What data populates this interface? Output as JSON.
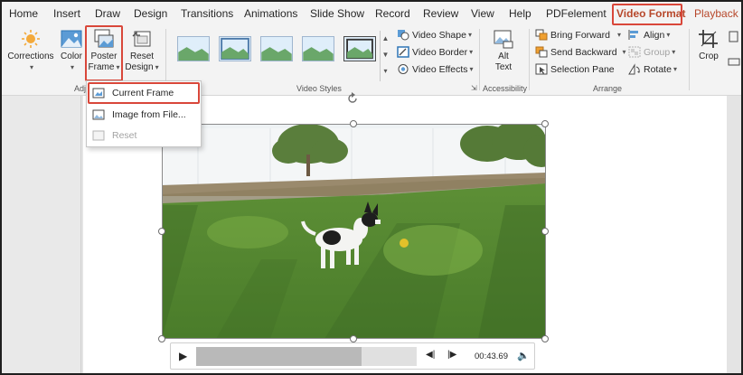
{
  "tabs": [
    "Home",
    "Insert",
    "Draw",
    "Design",
    "Transitions",
    "Animations",
    "Slide Show",
    "Record",
    "Review",
    "View",
    "Help",
    "PDFelement",
    "Video Format",
    "Playback"
  ],
  "ribbon": {
    "adjust": {
      "corrections": "Corrections",
      "color": "Color",
      "poster_frame_1": "Poster",
      "poster_frame_2": "Frame",
      "reset_design_1": "Reset",
      "reset_design_2": "Design",
      "label": "Adj"
    },
    "video_styles": {
      "video_shape": "Video Shape",
      "video_border": "Video Border",
      "video_effects": "Video Effects",
      "label": "Video Styles"
    },
    "accessibility": {
      "alt_text_1": "Alt",
      "alt_text_2": "Text",
      "label": "Accessibility"
    },
    "arrange": {
      "bring_forward": "Bring Forward",
      "send_backward": "Send Backward",
      "selection_pane": "Selection Pane",
      "align": "Align",
      "group": "Group",
      "rotate": "Rotate",
      "label": "Arrange"
    },
    "size": {
      "crop": "Crop"
    }
  },
  "poster_frame_menu": {
    "current_frame": "Current Frame",
    "image_from_file": "Image from File...",
    "reset": "Reset"
  },
  "player": {
    "time": "00:43.69",
    "progress": 0.75
  },
  "colors": {
    "accent": "#b7472a",
    "highlight": "#d9473a"
  }
}
